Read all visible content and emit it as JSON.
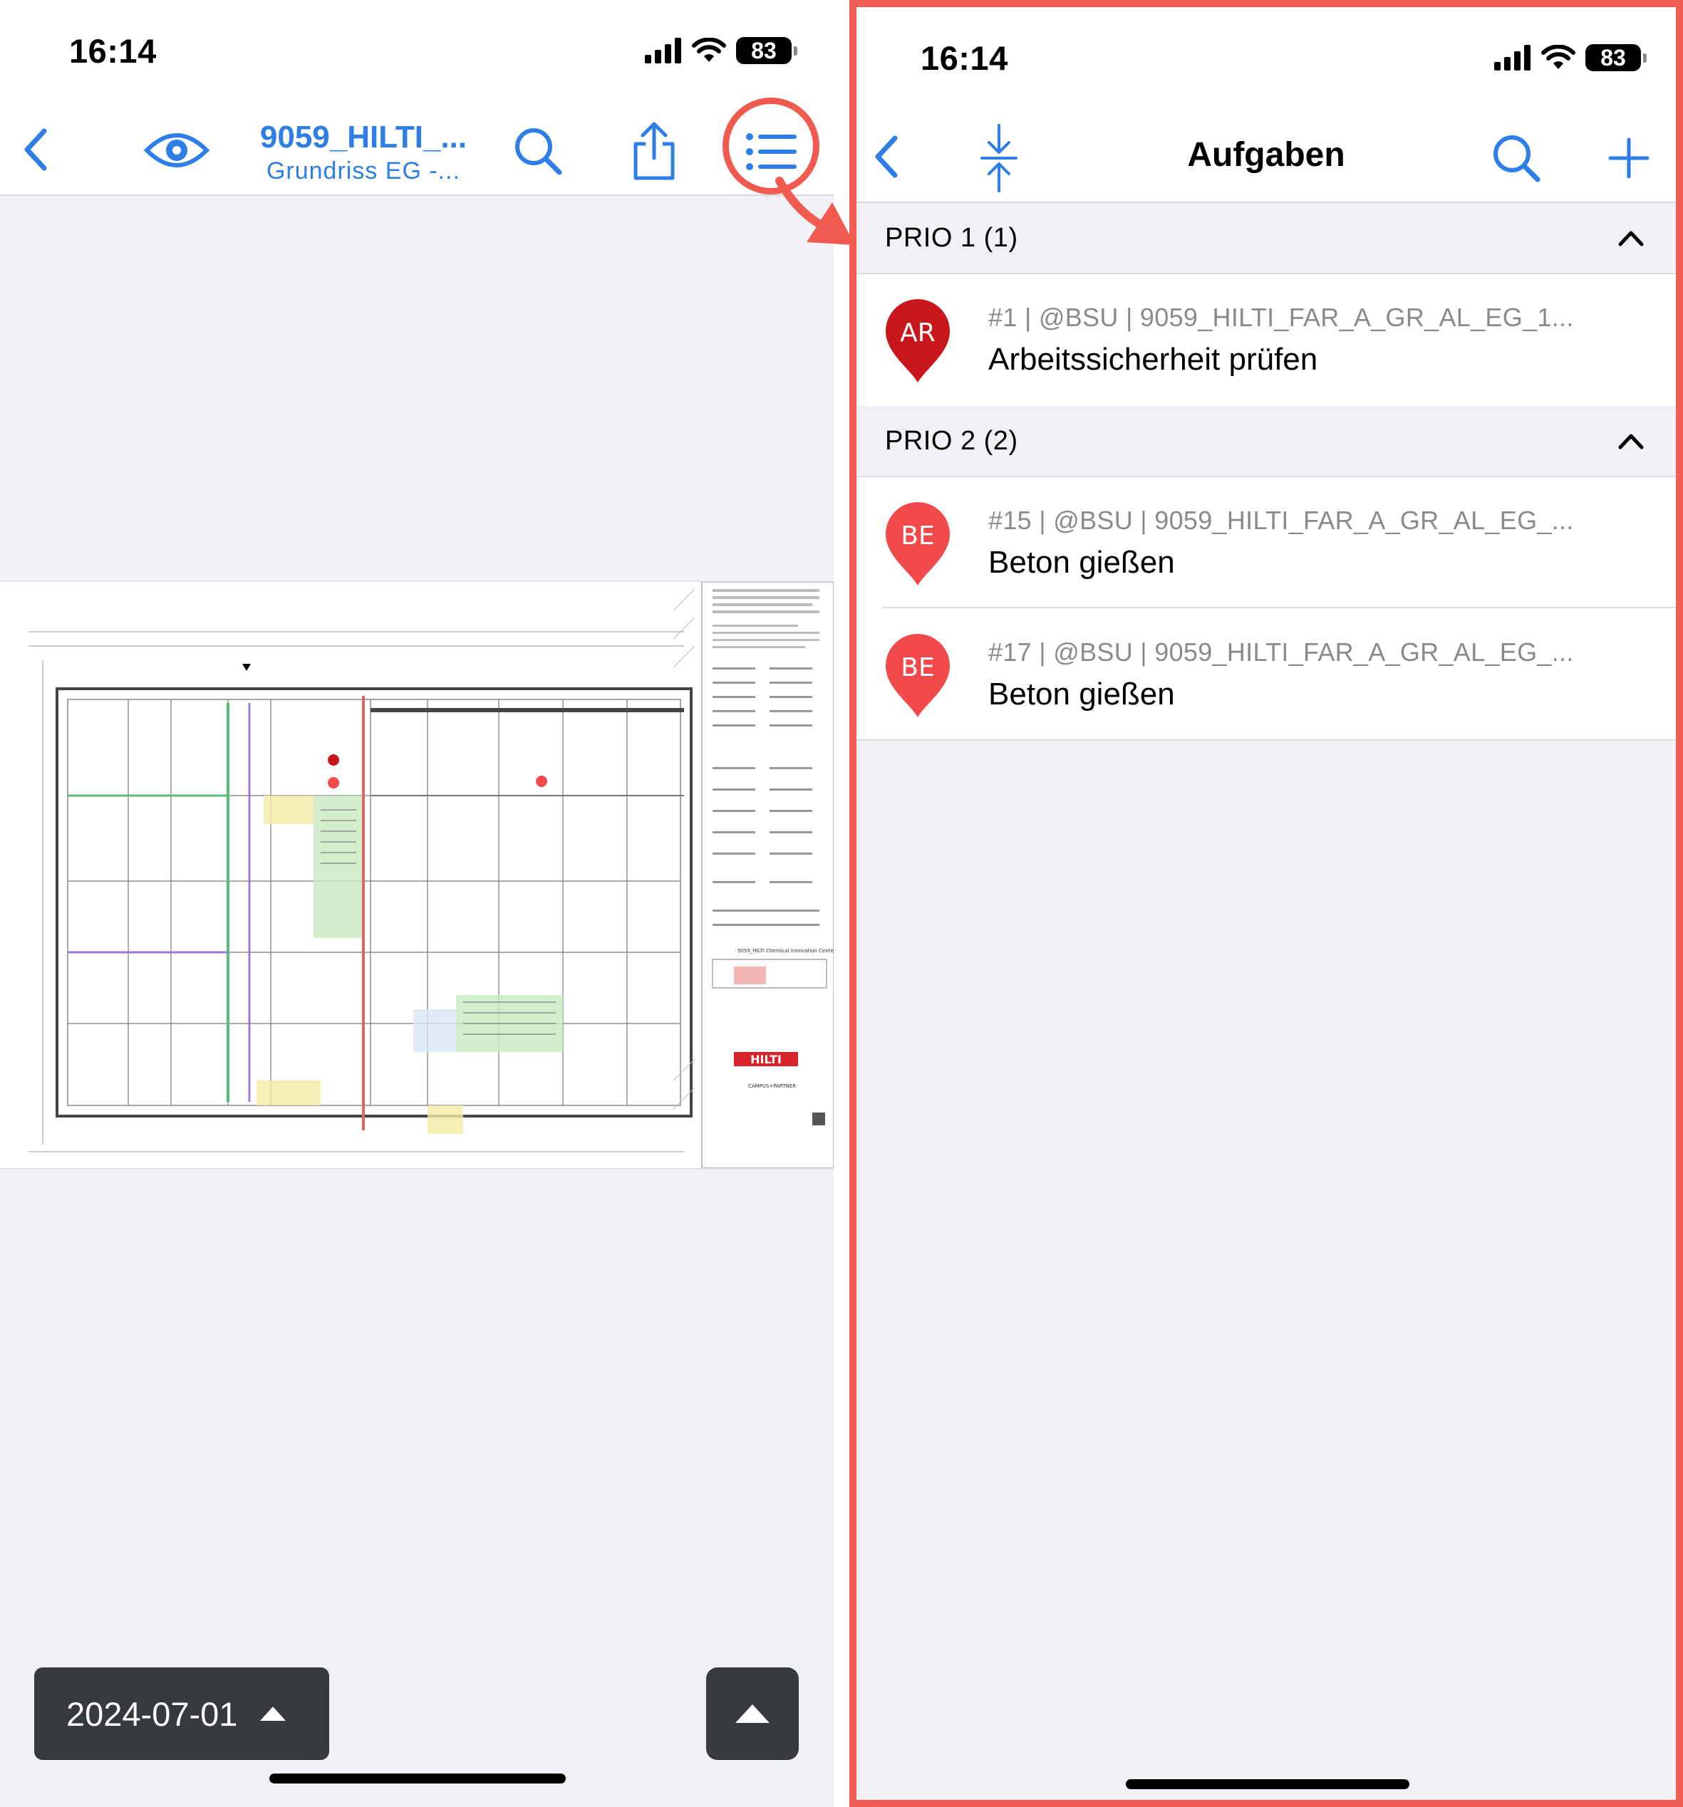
{
  "left": {
    "status": {
      "time": "16:14",
      "battery": "83"
    },
    "nav": {
      "title": "9059_HILTI_...",
      "subtitle": "Grundriss EG -..."
    },
    "date_selector": {
      "label": "2024-07-01"
    },
    "plan": {
      "title_block": {
        "company": "HILTI",
        "project": "9059_HILTI  Chemical Innovation Center",
        "partner": "CAMPUS+PARTNER"
      }
    }
  },
  "right": {
    "status": {
      "time": "16:14",
      "battery": "83"
    },
    "nav": {
      "title": "Aufgaben"
    },
    "sections": [
      {
        "header": "PRIO 1 (1)",
        "tasks": [
          {
            "badge": "AR",
            "meta": "#1 | @BSU | 9059_HILTI_FAR_A_GR_AL_EG_1...",
            "title": "Arbeitssicherheit prüfen",
            "color": "#c8171c"
          }
        ]
      },
      {
        "header": "PRIO 2 (2)",
        "tasks": [
          {
            "badge": "BE",
            "meta": "#15 | @BSU | 9059_HILTI_FAR_A_GR_AL_EG_...",
            "title": "Beton gießen",
            "color": "#f2494a"
          },
          {
            "badge": "BE",
            "meta": "#17 | @BSU | 9059_HILTI_FAR_A_GR_AL_EG_...",
            "title": "Beton gießen",
            "color": "#f2494a"
          }
        ]
      }
    ]
  },
  "colors": {
    "accent": "#2d7ee6",
    "highlight": "#f05a4f",
    "dark_button": "#36393d"
  }
}
